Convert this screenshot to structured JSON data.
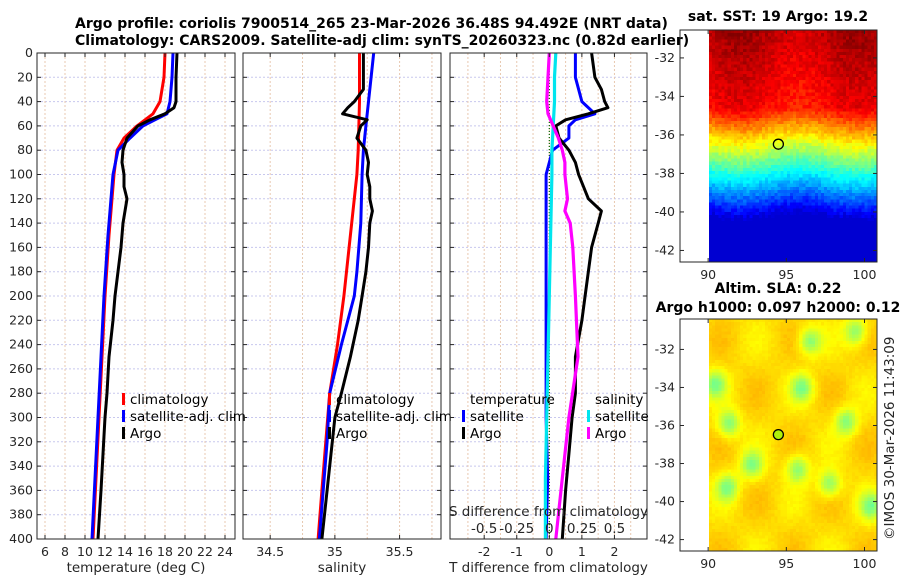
{
  "title_line1": "Argo profile: coriolis 7900514_265 23-Mar-2026 36.48S 94.492E (NRT data)",
  "title_line2": "Climatology: CARS2009. Satellite-adj clim: synTS_20260323.nc (0.82d earlier)",
  "footer": "©IMOS 30-Mar-2026 11:43:09",
  "chart_data": [
    {
      "type": "line",
      "xlabel": "temperature (deg C)",
      "ylabel": "",
      "xlim": [
        5.2,
        25
      ],
      "ylim": [
        400,
        0
      ],
      "xticks": [
        6,
        8,
        10,
        12,
        14,
        16,
        18,
        20,
        22,
        24
      ],
      "yticks": [
        0,
        20,
        40,
        60,
        80,
        100,
        120,
        140,
        160,
        180,
        200,
        220,
        240,
        260,
        280,
        300,
        320,
        340,
        360,
        380,
        400
      ],
      "grid": true,
      "legend_position": "bottom-right",
      "series": [
        {
          "name": "climatology",
          "color": "#ff0000",
          "depth": [
            0,
            20,
            40,
            50,
            60,
            70,
            80,
            100,
            150,
            200,
            250,
            300,
            350,
            400
          ],
          "values": [
            18.0,
            17.9,
            17.5,
            16.8,
            15.2,
            13.9,
            13.2,
            12.9,
            12.4,
            12.0,
            11.7,
            11.4,
            11.1,
            10.8
          ]
        },
        {
          "name": "satellite-adj. clim",
          "color": "#0000ff",
          "depth": [
            0,
            20,
            40,
            50,
            55,
            60,
            70,
            80,
            100,
            150,
            200,
            250,
            300,
            350,
            400
          ],
          "values": [
            18.8,
            18.7,
            18.5,
            18.2,
            17.0,
            15.8,
            14.5,
            13.3,
            12.8,
            12.3,
            11.9,
            11.6,
            11.3,
            11.0,
            10.7
          ]
        },
        {
          "name": "Argo",
          "color": "#000000",
          "depth": [
            0,
            20,
            40,
            45,
            50,
            55,
            60,
            70,
            80,
            90,
            100,
            110,
            120,
            130,
            140,
            160,
            180,
            200,
            220,
            250,
            280,
            300,
            330,
            360,
            400
          ],
          "values": [
            19.2,
            19.1,
            19.1,
            18.9,
            18.0,
            16.5,
            15.3,
            14.2,
            13.8,
            13.7,
            13.9,
            13.9,
            14.2,
            14.0,
            13.8,
            13.6,
            13.3,
            13.0,
            12.8,
            12.4,
            12.2,
            12.0,
            11.8,
            11.6,
            11.3
          ]
        }
      ]
    },
    {
      "type": "line",
      "xlabel": "salinity",
      "ylabel": "",
      "xlim": [
        34.29,
        35.82
      ],
      "ylim": [
        400,
        0
      ],
      "xticks": [
        34.5,
        35,
        35.5
      ],
      "yticks": [
        0,
        20,
        40,
        60,
        80,
        100,
        120,
        140,
        160,
        180,
        200,
        220,
        240,
        260,
        280,
        300,
        320,
        340,
        360,
        380,
        400
      ],
      "grid": true,
      "legend_position": "bottom-right",
      "series": [
        {
          "name": "climatology",
          "color": "#ff0000",
          "depth": [
            0,
            40,
            80,
            100,
            120,
            160,
            200,
            240,
            280,
            320,
            360,
            400
          ],
          "values": [
            35.19,
            35.19,
            35.18,
            35.17,
            35.15,
            35.11,
            35.07,
            35.02,
            34.96,
            34.93,
            34.9,
            34.87
          ]
        },
        {
          "name": "satellite-adj. clim",
          "color": "#0000ff",
          "depth": [
            0,
            20,
            40,
            60,
            80,
            100,
            140,
            180,
            200,
            240,
            280,
            320,
            360,
            400
          ],
          "values": [
            35.3,
            35.28,
            35.26,
            35.24,
            35.22,
            35.21,
            35.2,
            35.17,
            35.15,
            35.05,
            34.96,
            34.94,
            34.91,
            34.88
          ]
        },
        {
          "name": "Argo",
          "color": "#000000",
          "depth": [
            0,
            20,
            30,
            40,
            45,
            50,
            55,
            60,
            70,
            80,
            90,
            100,
            110,
            120,
            130,
            140,
            160,
            180,
            200,
            220,
            250,
            280,
            300,
            330,
            360,
            400
          ],
          "values": [
            35.22,
            35.22,
            35.22,
            35.15,
            35.1,
            35.06,
            35.25,
            35.2,
            35.17,
            35.24,
            35.26,
            35.25,
            35.27,
            35.27,
            35.29,
            35.27,
            35.26,
            35.24,
            35.21,
            35.18,
            35.12,
            35.05,
            35.0,
            34.97,
            34.94,
            34.9
          ]
        }
      ]
    },
    {
      "type": "line",
      "xlabel": "T difference from climatology",
      "x2label": "S difference from climatology",
      "xlim": [
        -3.05,
        3.0
      ],
      "x2lim": [
        -0.7625,
        0.75
      ],
      "ylim": [
        400,
        0
      ],
      "xticks": [
        -2,
        -1,
        0,
        1,
        2
      ],
      "x2ticks": [
        -0.5,
        -0.25,
        0,
        0.25,
        0.5
      ],
      "x2ticklabels": [
        "-0.5",
        "-0.25",
        "0",
        "0.25",
        "0.5"
      ],
      "yticks": [
        0,
        20,
        40,
        60,
        80,
        100,
        120,
        140,
        160,
        180,
        200,
        220,
        240,
        260,
        280,
        300,
        320,
        340,
        360,
        380,
        400
      ],
      "grid": true,
      "legend_position": "bottom",
      "legend_headers": [
        "temperature",
        "salinity"
      ],
      "series": [
        {
          "name": "satellite",
          "group": "temperature",
          "axis": "T",
          "color": "#0000ff",
          "depth": [
            0,
            20,
            40,
            50,
            55,
            60,
            70,
            80,
            100,
            150,
            200,
            250,
            300,
            350,
            400
          ],
          "values": [
            0.8,
            0.8,
            1.0,
            1.4,
            0.8,
            0.6,
            0.6,
            0.1,
            -0.1,
            -0.1,
            -0.1,
            -0.1,
            -0.1,
            -0.05,
            -0.1
          ]
        },
        {
          "name": "Argo",
          "group": "temperature",
          "axis": "T",
          "color": "#000000",
          "depth": [
            0,
            20,
            30,
            40,
            45,
            50,
            55,
            60,
            70,
            80,
            90,
            100,
            120,
            130,
            140,
            160,
            200,
            220,
            250,
            280,
            300,
            330,
            360,
            400
          ],
          "values": [
            1.3,
            1.4,
            1.6,
            1.7,
            1.8,
            1.2,
            0.5,
            0.2,
            0.3,
            0.6,
            0.8,
            0.9,
            1.2,
            1.6,
            1.5,
            1.3,
            1.1,
            1.0,
            0.8,
            0.8,
            0.7,
            0.6,
            0.5,
            0.4
          ]
        },
        {
          "name": "satellite",
          "group": "salinity",
          "axis": "S",
          "color": "#00e5ee",
          "depth": [
            0,
            20,
            40,
            60,
            80,
            100,
            150,
            200,
            250,
            300,
            350,
            400
          ],
          "values": [
            0.05,
            0.04,
            0.04,
            0.03,
            0.02,
            0.02,
            0.01,
            0.0,
            -0.01,
            -0.02,
            -0.03,
            -0.03
          ]
        },
        {
          "name": "Argo",
          "group": "salinity",
          "axis": "S",
          "color": "#ff00ff",
          "depth": [
            0,
            20,
            40,
            50,
            60,
            70,
            80,
            90,
            100,
            120,
            130,
            140,
            160,
            200,
            250,
            300,
            350,
            400
          ],
          "values": [
            0.0,
            -0.01,
            -0.02,
            -0.01,
            0.03,
            0.07,
            0.1,
            0.12,
            0.12,
            0.14,
            0.12,
            0.16,
            0.18,
            0.2,
            0.22,
            0.15,
            0.1,
            0.05
          ]
        }
      ]
    }
  ],
  "maps": [
    {
      "title": "sat. SST: 19 Argo: 19.2",
      "variable": "SST",
      "lon_ticks": [
        90,
        95,
        100
      ],
      "lat_ticks": [
        -32,
        -34,
        -36,
        -38,
        -40,
        -42
      ],
      "lon_range": [
        88.2,
        100.8
      ],
      "lat_range": [
        -42.6,
        -30.55
      ],
      "marker": {
        "lon": 94.492,
        "lat": -36.48
      }
    },
    {
      "title": "Altim. SLA: 0.22",
      "subtitle": "Argo h1000: 0.097 h2000: 0.12",
      "variable": "SLA",
      "lon_ticks": [
        90,
        95,
        100
      ],
      "lat_ticks": [
        -32,
        -34,
        -36,
        -38,
        -40,
        -42
      ],
      "lon_range": [
        88.2,
        100.8
      ],
      "lat_range": [
        -42.6,
        -30.4
      ],
      "marker": {
        "lon": 94.492,
        "lat": -36.48
      }
    }
  ]
}
